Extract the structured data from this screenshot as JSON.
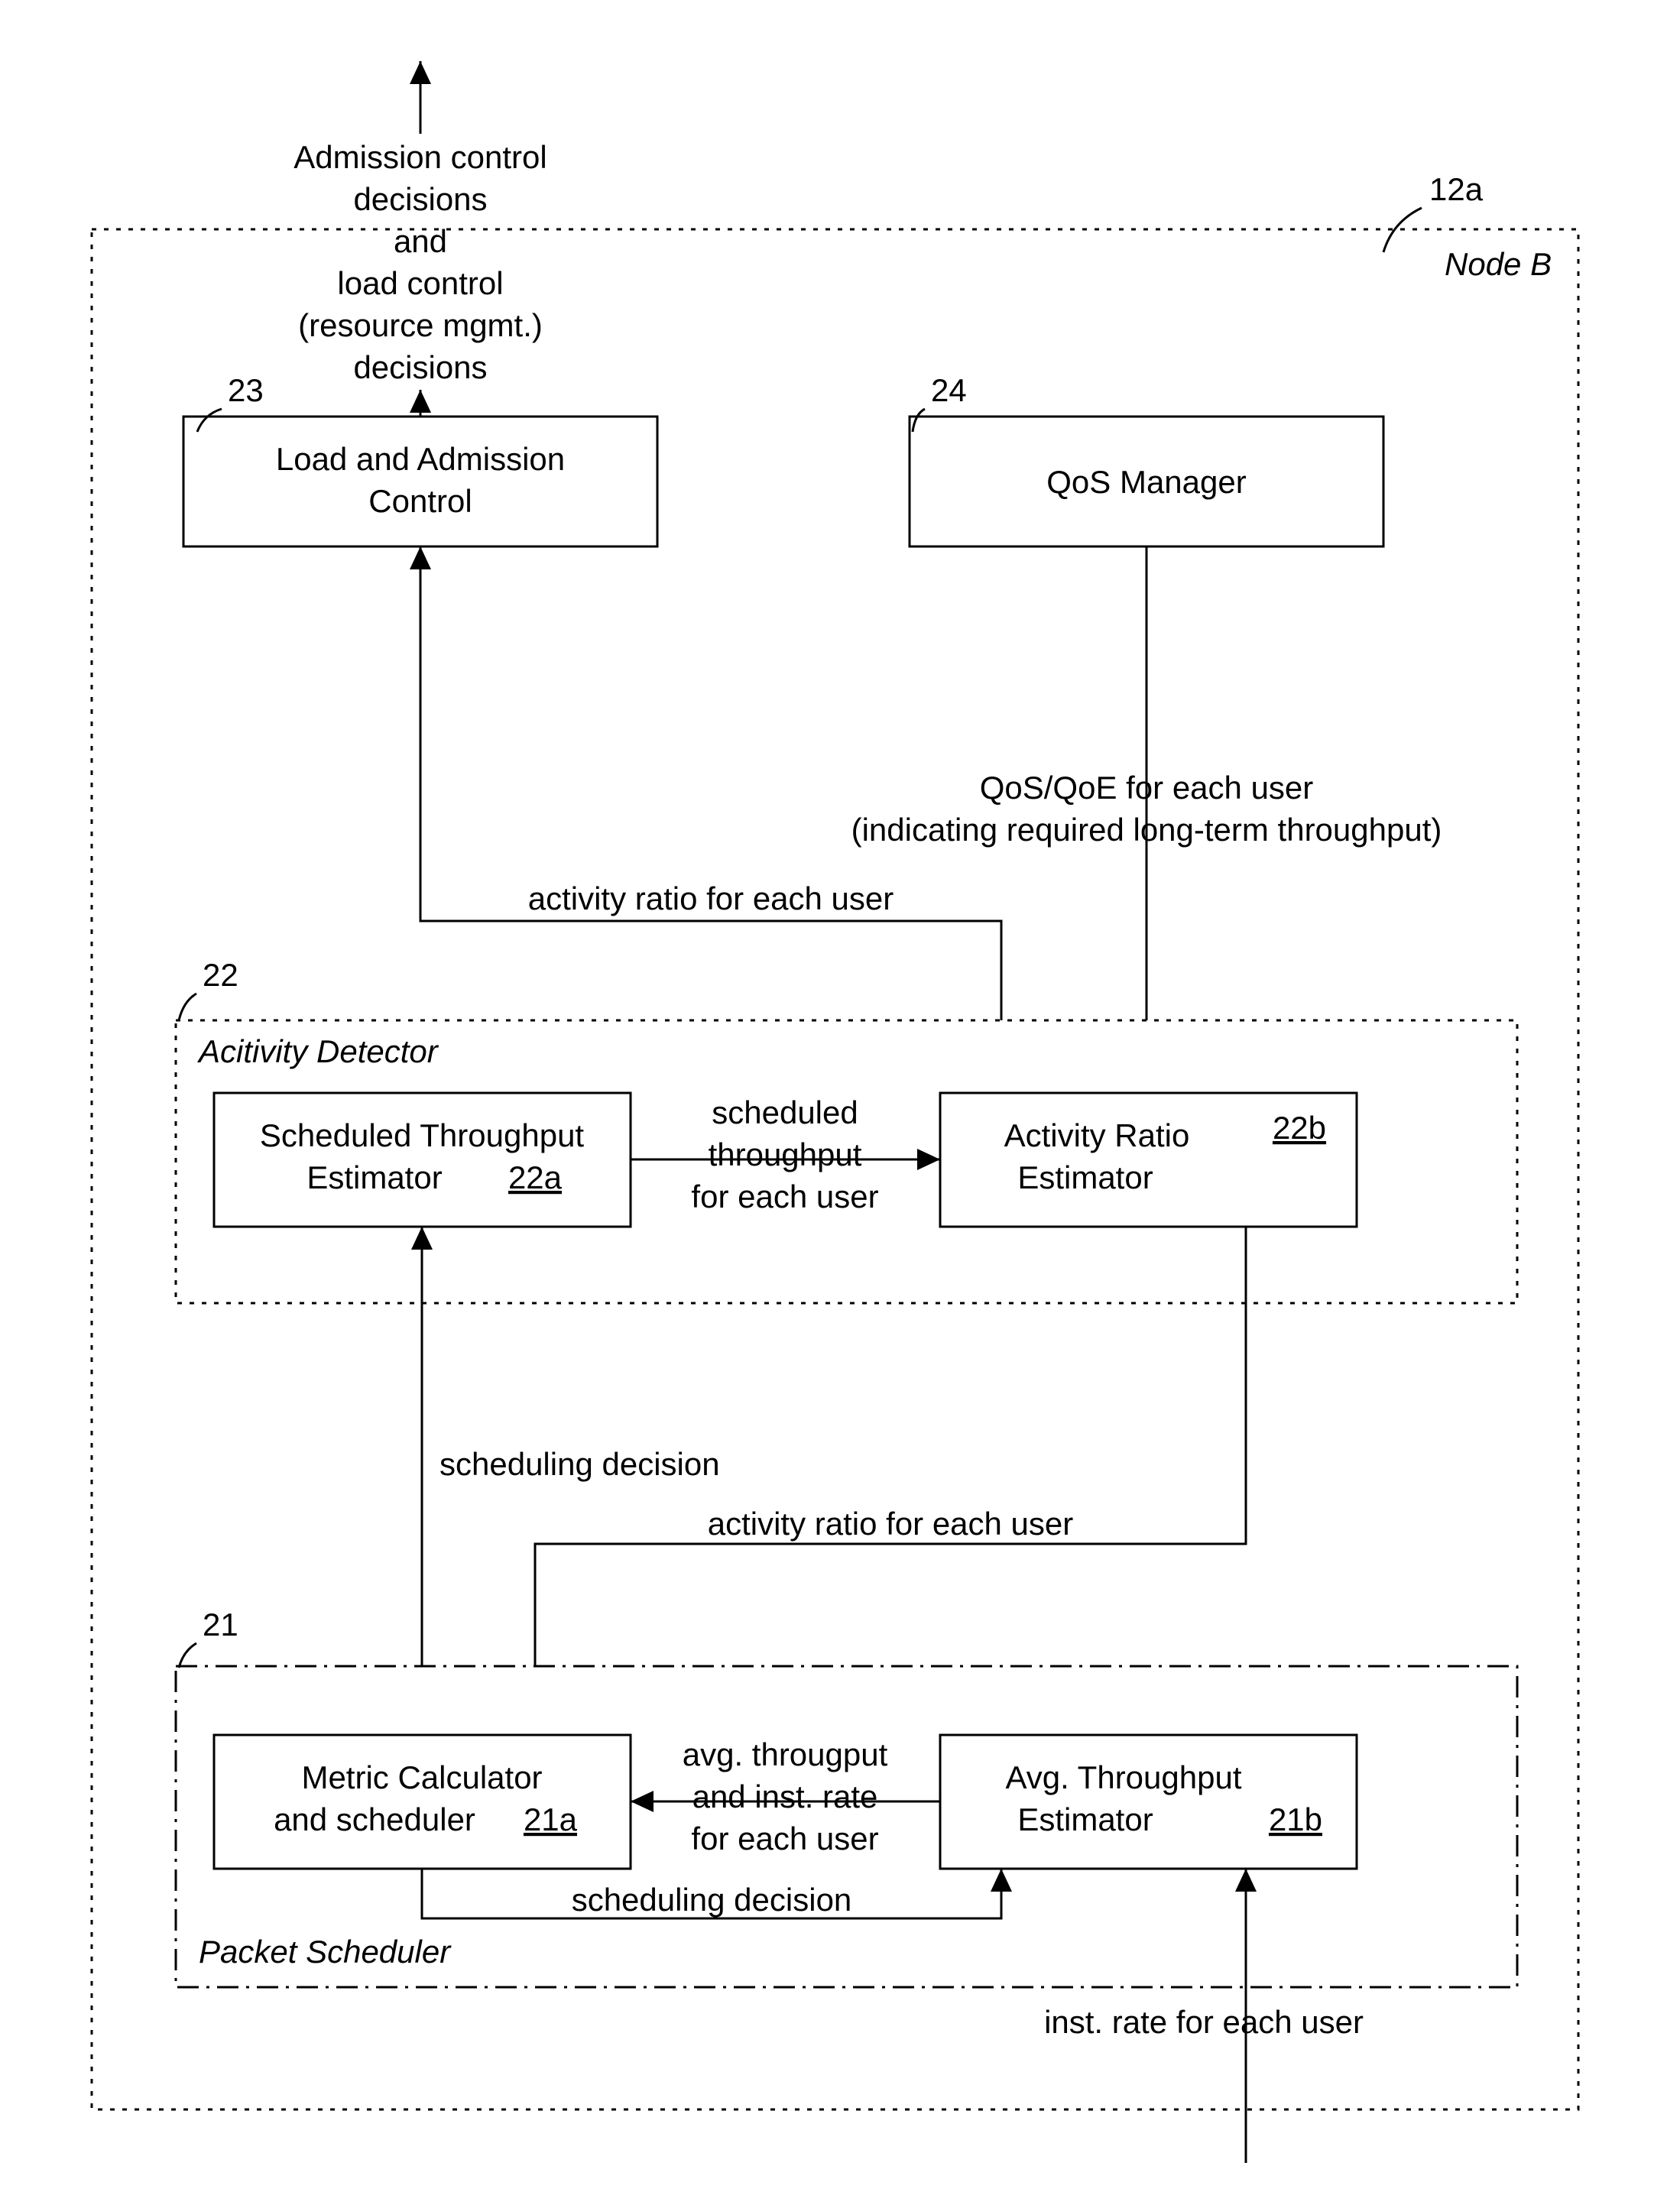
{
  "outer": {
    "label": "Node B",
    "ref": "12a"
  },
  "outputArrow": {
    "l1": "Admission control",
    "l2": "decisions",
    "l3": "and",
    "l4": "load control",
    "l5": "(resource mgmt.)",
    "l6": "decisions"
  },
  "lac": {
    "ref": "23",
    "l1": "Load and Admission",
    "l2": "Control"
  },
  "qos": {
    "ref": "24",
    "label": "QoS Manager"
  },
  "qosEdge": {
    "l1": "QoS/QoE for each user",
    "l2": "(indicating required long-term throughput)"
  },
  "activityRatioUp": "activity ratio for each user",
  "detector": {
    "ref": "22",
    "label": "Acitivity Detector"
  },
  "ste": {
    "l1": "Scheduled Throughput",
    "l2": "Estimator",
    "ref": "22a"
  },
  "are": {
    "l1": "Activity Ratio",
    "l2": "Estimator",
    "ref": "22b"
  },
  "steToAre": {
    "l1": "scheduled",
    "l2": "throughput",
    "l3": "for each user"
  },
  "schedDecisionUp": "scheduling decision",
  "activityRatioDown": "activity ratio for each user",
  "scheduler": {
    "ref": "21",
    "label": "Packet Scheduler"
  },
  "mc": {
    "l1": "Metric Calculator",
    "l2": "and scheduler",
    "ref": "21a"
  },
  "ate": {
    "l1": "Avg. Throughput",
    "l2": "Estimator",
    "ref": "21b"
  },
  "ateToMc": {
    "l1": "avg. througput",
    "l2": "and inst. rate",
    "l3": "for each user"
  },
  "schedDecisionLoop": "scheduling decision",
  "instRate": "inst. rate for each user"
}
